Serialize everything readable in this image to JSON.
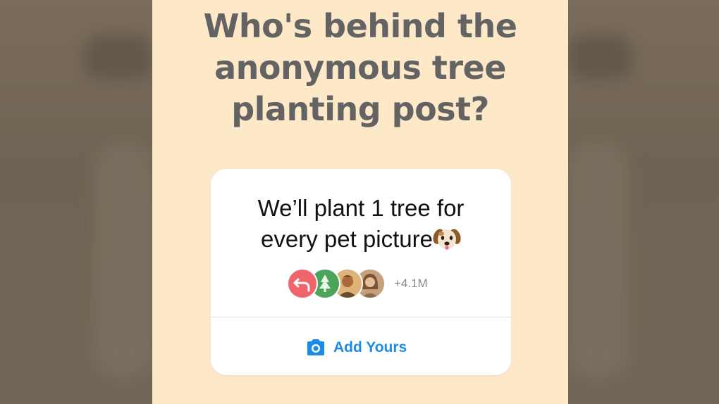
{
  "headline": {
    "line1": "Who's behind the",
    "line2": "anonymous tree",
    "line3": "planting post?"
  },
  "sticker": {
    "prompt_line1": "We’ll plant 1 tree for",
    "prompt_line2": "every pet picture",
    "prompt_emoji": "dog-face-icon",
    "participant_count": "+4.1M",
    "participants": [
      {
        "name": "reshare-avatar",
        "color": "#f0646b"
      },
      {
        "name": "plant-a-tree-avatar",
        "color": "#4aa55a"
      },
      {
        "name": "user-avatar-1",
        "color": "#d9a56b"
      },
      {
        "name": "user-avatar-2",
        "color": "#b58a68"
      }
    ],
    "action_label": "Add Yours",
    "action_icon": "camera-icon",
    "accent_color": "#1d8ce8"
  },
  "colors": {
    "panel_bg": "#fde8c7",
    "headline_text": "#636363",
    "card_bg": "#ffffff"
  }
}
